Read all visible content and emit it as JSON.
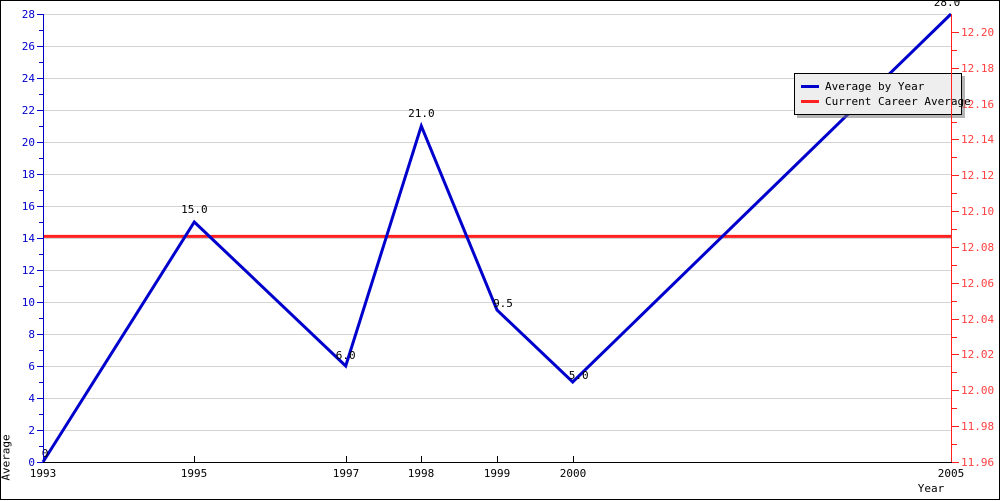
{
  "chart_data": {
    "type": "line",
    "title": "",
    "xlabel": "Year",
    "ylabel": "Average",
    "grid": true,
    "legend_position": "top-right",
    "x": [
      "1993",
      "1995",
      "1997",
      "1998",
      "1999",
      "2000",
      "2005"
    ],
    "x_positions": [
      1993,
      1995,
      1997,
      1998,
      1999,
      2000,
      2005
    ],
    "xlim": [
      1993,
      2005
    ],
    "ylim": [
      0,
      28
    ],
    "y_ticks": [
      0,
      2,
      4,
      6,
      8,
      10,
      12,
      14,
      16,
      18,
      20,
      22,
      24,
      26,
      28
    ],
    "y_tick_labels": [
      "0",
      "2",
      "4",
      "6",
      "8",
      "10",
      "12",
      "14",
      "16",
      "18",
      "20",
      "22",
      "24",
      "26",
      "28"
    ],
    "y2lim": [
      11.96,
      12.21
    ],
    "y2_ticks": [
      11.96,
      11.98,
      12.0,
      12.02,
      12.04,
      12.06,
      12.08,
      12.1,
      12.12,
      12.14,
      12.16,
      12.18,
      12.2
    ],
    "y2_tick_labels": [
      "11.96",
      "11.98",
      "12.00",
      "12.02",
      "12.04",
      "12.06",
      "12.08",
      "12.10",
      "12.12",
      "12.14",
      "12.16",
      "12.18",
      "12.20"
    ],
    "series": [
      {
        "name": "Average by Year",
        "color": "#0000cc",
        "values": [
          0.0,
          15.0,
          6.0,
          21.0,
          9.5,
          5.0,
          28.0
        ],
        "point_labels": [
          "0",
          "15.0",
          "6.0",
          "21.0",
          "9.5",
          "5.0",
          "28.0"
        ]
      },
      {
        "name": "Current Career Average",
        "color": "#ff2020",
        "type": "hline",
        "value": 14.1
      }
    ]
  },
  "legend": {
    "items": [
      {
        "label": "Average by Year",
        "color": "#0000cc"
      },
      {
        "label": "Current Career Average",
        "color": "#ff2020"
      }
    ]
  },
  "axes": {
    "left_title": "Average",
    "bottom_title": "Year",
    "left_color": "#0000cc",
    "right_color": "#ff4040",
    "bottom_color": "#000000"
  }
}
